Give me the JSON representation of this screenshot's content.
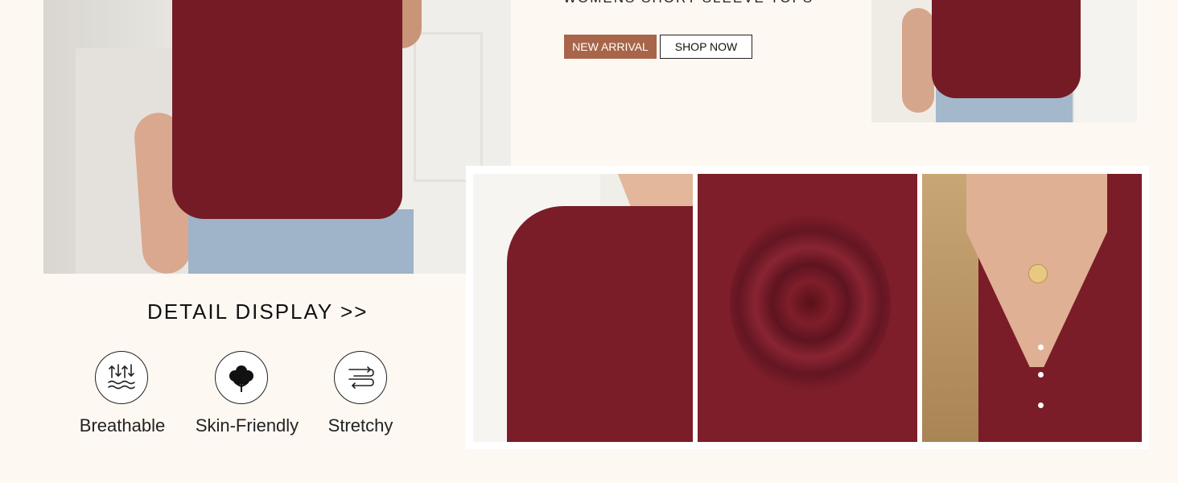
{
  "header": {
    "tagline": "WOMENS SHORT SLEEVE TOPS",
    "new_arrival_label": "NEW ARRIVAL",
    "shop_now_label": "SHOP NOW"
  },
  "details": {
    "heading": "DETAIL DISPLAY >>",
    "features": [
      {
        "label": "Breathable",
        "icon": "breathable-waves-icon"
      },
      {
        "label": "Skin-Friendly",
        "icon": "cotton-flower-icon"
      },
      {
        "label": "Stretchy",
        "icon": "stretch-arrows-icon"
      }
    ]
  },
  "colors": {
    "background": "#fdf8f2",
    "product_burgundy": "#741b26",
    "new_arrival_badge": "#a8654a"
  }
}
